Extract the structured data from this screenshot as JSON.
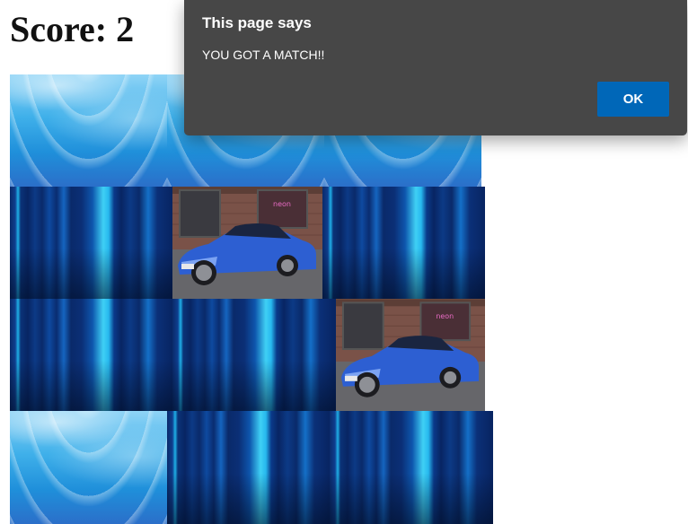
{
  "game": {
    "score_text": "Score: 2"
  },
  "board": {
    "tiles": [
      {
        "row": 1,
        "col": 1,
        "state": "face-down",
        "pattern": "wave"
      },
      {
        "row": 1,
        "col": 2,
        "state": "face-down",
        "pattern": "wave"
      },
      {
        "row": 1,
        "col": 3,
        "state": "face-down",
        "pattern": "wave"
      },
      {
        "row": 2,
        "col": 1,
        "state": "face-down",
        "pattern": "stripes"
      },
      {
        "row": 2,
        "col": 2,
        "state": "revealed",
        "image": "blue-sports-car"
      },
      {
        "row": 2,
        "col": 3,
        "state": "face-down",
        "pattern": "stripes"
      },
      {
        "row": 3,
        "col": 1,
        "state": "face-down",
        "pattern": "stripes"
      },
      {
        "row": 3,
        "col": 2,
        "state": "face-down",
        "pattern": "stripes"
      },
      {
        "row": 3,
        "col": 3,
        "state": "revealed",
        "image": "blue-sports-car"
      },
      {
        "row": 4,
        "col": 1,
        "state": "face-down",
        "pattern": "wave"
      },
      {
        "row": 4,
        "col": 2,
        "state": "face-down",
        "pattern": "stripes"
      },
      {
        "row": 4,
        "col": 3,
        "state": "face-down",
        "pattern": "stripes"
      }
    ]
  },
  "dialog": {
    "title": "This page says",
    "message": "YOU GOT A MATCH!!",
    "ok_label": "OK"
  },
  "colors": {
    "dialog_bg": "#474747",
    "button_blue": "#0067b8"
  }
}
